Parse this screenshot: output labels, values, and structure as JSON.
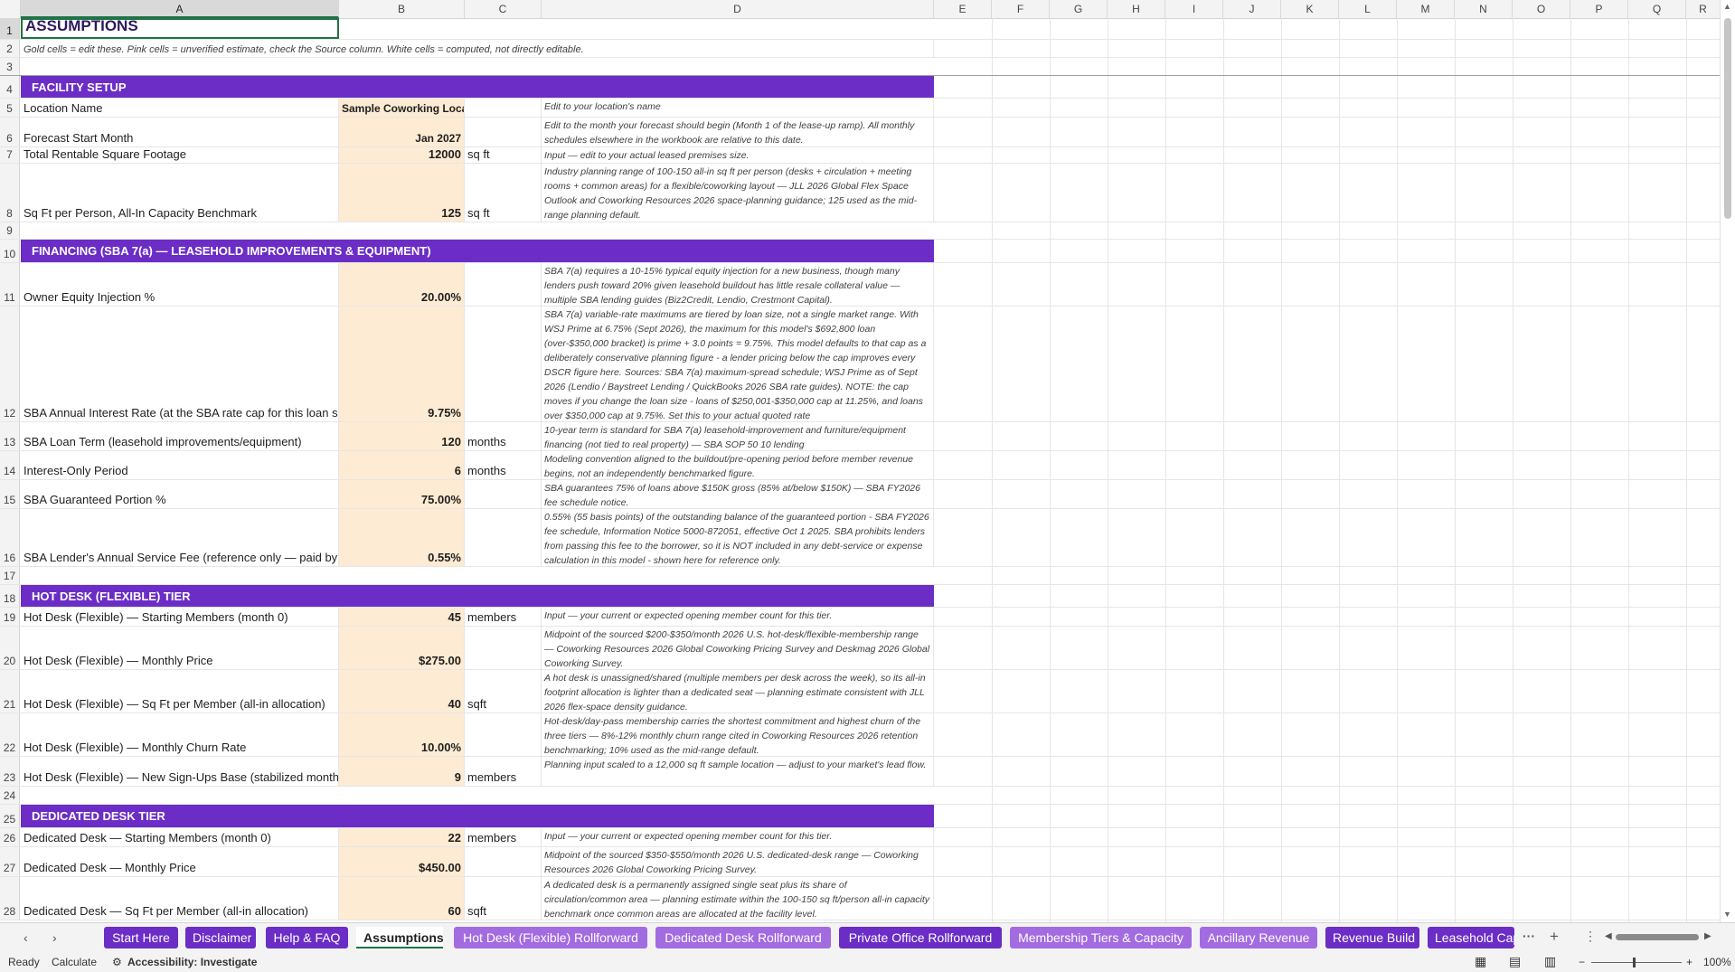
{
  "columns": [
    "A",
    "B",
    "C",
    "D",
    "E",
    "F",
    "G",
    "H",
    "I",
    "J",
    "K",
    "L",
    "M",
    "N",
    "O",
    "P",
    "Q",
    "R"
  ],
  "rows": {
    "r1": {
      "num": "1",
      "a": "ASSUMPTIONS"
    },
    "r2": {
      "num": "2",
      "a": "Gold cells = edit these. Pink cells = unverified estimate, check the Source column. White cells = computed, not directly editable."
    },
    "r3": {
      "num": "3"
    },
    "r4": {
      "num": "4",
      "a": "FACILITY SETUP"
    },
    "r5": {
      "num": "5",
      "a": "Location Name",
      "b": "Sample Coworking Location",
      "d": "Edit to your location's name"
    },
    "r6": {
      "num": "6",
      "a": "Forecast Start Month",
      "b": "Jan 2027",
      "d": "Edit to the month your forecast should begin (Month 1 of the lease-up ramp). All monthly schedules elsewhere in the workbook are relative to this date."
    },
    "r7": {
      "num": "7",
      "a": "Total Rentable Square Footage",
      "b": "12000",
      "c": "sq ft",
      "d": "Input — edit to your actual leased premises size."
    },
    "r8": {
      "num": "8",
      "a": "Sq Ft per Person, All-In Capacity Benchmark",
      "b": "125",
      "c": "sq ft",
      "d": "Industry planning range of 100-150 all-in sq ft per person (desks + circulation + meeting rooms + common areas) for a flexible/coworking layout — JLL 2026 Global Flex Space Outlook and Coworking Resources 2026 space-planning guidance; 125 used as the mid-range planning default."
    },
    "r9": {
      "num": "9"
    },
    "r10": {
      "num": "10",
      "a": "FINANCING (SBA 7(a) — LEASEHOLD IMPROVEMENTS & EQUIPMENT)"
    },
    "r11": {
      "num": "11",
      "a": "Owner Equity Injection %",
      "b": "20.00%",
      "d": "SBA 7(a) requires a 10-15% typical equity injection for a new business, though many lenders push toward 20% given leasehold buildout has little resale collateral value — multiple SBA lending guides (Biz2Credit, Lendio, Crestmont Capital)."
    },
    "r12": {
      "num": "12",
      "a": "SBA Annual Interest Rate (at the SBA rate cap for this loan size)",
      "b": "9.75%",
      "d": "SBA 7(a) variable-rate maximums are tiered by loan size, not a single market range. With WSJ Prime at 6.75% (Sept 2026), the maximum for this model's $692,800 loan (over-$350,000 bracket) is prime + 3.0 points = 9.75%. This model defaults to that cap as a deliberately conservative planning figure - a lender pricing below the cap improves every DSCR figure here. Sources: SBA 7(a) maximum-spread schedule; WSJ Prime as of Sept 2026 (Lendio / Baystreet Lending / QuickBooks 2026 SBA rate guides). NOTE: the cap moves if you change the loan size - loans of $250,001-$350,000 cap at 11.25%, and loans over $350,000 cap at 9.75%. Set this to your actual quoted rate"
    },
    "r13": {
      "num": "13",
      "a": "SBA Loan Term (leasehold improvements/equipment)",
      "b": "120",
      "c": "months",
      "d": "10-year term is standard for SBA 7(a) leasehold-improvement and furniture/equipment financing (not tied to real property) — SBA SOP 50 10 lending"
    },
    "r14": {
      "num": "14",
      "a": "Interest-Only Period",
      "b": "6",
      "c": "months",
      "d": "Modeling convention aligned to the buildout/pre-opening period before member revenue begins, not an independently benchmarked figure."
    },
    "r15": {
      "num": "15",
      "a": "SBA Guaranteed Portion %",
      "b": "75.00%",
      "d": "SBA guarantees 75% of loans above $150K gross (85% at/below $150K) — SBA FY2026 fee schedule notice."
    },
    "r16": {
      "num": "16",
      "a": "SBA Lender's Annual Service Fee (reference only — paid by the lender)",
      "b": "0.55%",
      "d": "0.55% (55 basis points) of the outstanding balance of the guaranteed portion - SBA FY2026 fee schedule, Information Notice 5000-872051, effective Oct 1 2025. SBA prohibits lenders from passing this fee to the borrower, so it is NOT included in any debt-service or expense calculation in this model - shown here for reference only."
    },
    "r17": {
      "num": "17"
    },
    "r18": {
      "num": "18",
      "a": "HOT DESK (FLEXIBLE) TIER"
    },
    "r19": {
      "num": "19",
      "a": "Hot Desk (Flexible) — Starting Members (month 0)",
      "b": "45",
      "c": "members",
      "d": "Input — your current or expected opening member count for this tier."
    },
    "r20": {
      "num": "20",
      "a": "Hot Desk (Flexible) — Monthly Price",
      "b": "$275.00",
      "d": "Midpoint of the sourced $200-$350/month 2026 U.S. hot-desk/flexible-membership range — Coworking Resources 2026 Global Coworking Pricing Survey and Deskmag 2026 Global Coworking Survey."
    },
    "r21": {
      "num": "21",
      "a": "Hot Desk (Flexible) — Sq Ft per Member (all-in allocation)",
      "b": "40",
      "c": "sqft",
      "d": "A hot desk is unassigned/shared (multiple members per desk across the week), so its all-in footprint allocation is lighter than a dedicated seat — planning estimate consistent with JLL 2026 flex-space density guidance."
    },
    "r22": {
      "num": "22",
      "a": "Hot Desk (Flexible) — Monthly Churn Rate",
      "b": "10.00%",
      "d": "Hot-desk/day-pass membership carries the shortest commitment and highest churn of the three tiers — 8%-12% monthly churn range cited in Coworking Resources 2026 retention benchmarking; 10% used as the mid-range default."
    },
    "r23": {
      "num": "23",
      "a": "Hot Desk (Flexible) — New Sign-Ups Base (stabilized monthly pace)",
      "b": "9",
      "c": "members",
      "d": "Planning input scaled to a 12,000 sq ft sample location — adjust to your market's lead flow."
    },
    "r24": {
      "num": "24"
    },
    "r25": {
      "num": "25",
      "a": "DEDICATED DESK TIER"
    },
    "r26": {
      "num": "26",
      "a": "Dedicated Desk — Starting Members (month 0)",
      "b": "22",
      "c": "members",
      "d": "Input — your current or expected opening member count for this tier."
    },
    "r27": {
      "num": "27",
      "a": "Dedicated Desk — Monthly Price",
      "b": "$450.00",
      "d": "Midpoint of the sourced $350-$550/month 2026 U.S. dedicated-desk range — Coworking Resources 2026 Global Coworking Pricing Survey."
    },
    "r28": {
      "num": "28",
      "a": "Dedicated Desk — Sq Ft per Member (all-in allocation)",
      "b": "60",
      "c": "sqft",
      "d": "A dedicated desk is a permanently assigned single seat plus its share of circulation/common area — planning estimate within the 100-150 sq ft/person all-in capacity benchmark once common areas are allocated at the facility level."
    }
  },
  "tabs": [
    "Start Here",
    "Disclaimer",
    "Help & FAQ",
    "Assumptions",
    "Hot Desk (Flexible) Rollforward",
    "Dedicated Desk Rollforward",
    "Private Office Rollforward",
    "Membership Tiers & Capacity",
    "Ancillary Revenue",
    "Revenue Build",
    "Leasehold Cap"
  ],
  "status": {
    "ready": "Ready",
    "calculate": "Calculate",
    "accessibility": "Accessibility: Investigate",
    "zoom": "100%"
  },
  "colors": {
    "section": "#6b2dc6",
    "gold": "#fdebd3",
    "tab_light": "#a36be0"
  }
}
